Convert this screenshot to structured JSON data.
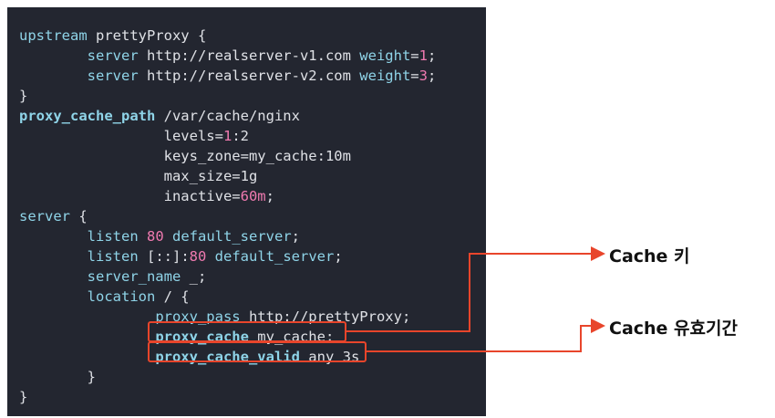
{
  "code_lines": [
    [
      {
        "t": "upstream",
        "c": "kw"
      },
      {
        "t": " prettyProxy {"
      }
    ],
    [
      {
        "t": "        "
      },
      {
        "t": "server",
        "c": "kw"
      },
      {
        "t": " http://realserver-v1.com "
      },
      {
        "t": "weight",
        "c": "kw"
      },
      {
        "t": "="
      },
      {
        "t": "1",
        "c": "num"
      },
      {
        "t": ";"
      }
    ],
    [
      {
        "t": "        "
      },
      {
        "t": "server",
        "c": "kw"
      },
      {
        "t": " http://realserver-v2.com "
      },
      {
        "t": "weight",
        "c": "kw"
      },
      {
        "t": "="
      },
      {
        "t": "3",
        "c": "num"
      },
      {
        "t": ";"
      }
    ],
    [
      {
        "t": "}"
      }
    ],
    [
      {
        "t": "proxy_cache_path",
        "c": "kwb"
      },
      {
        "t": " /var/cache/nginx"
      }
    ],
    [
      {
        "t": "                 levels="
      },
      {
        "t": "1",
        "c": "num"
      },
      {
        "t": ":2"
      }
    ],
    [
      {
        "t": "                 keys_zone=my_cache:10m"
      }
    ],
    [
      {
        "t": "                 max_size=1g"
      }
    ],
    [
      {
        "t": "                 inactive="
      },
      {
        "t": "60m",
        "c": "num"
      },
      {
        "t": ";"
      }
    ],
    [
      {
        "t": "server",
        "c": "kw"
      },
      {
        "t": " {"
      }
    ],
    [
      {
        "t": "        "
      },
      {
        "t": "listen",
        "c": "kw"
      },
      {
        "t": " "
      },
      {
        "t": "80",
        "c": "num"
      },
      {
        "t": " "
      },
      {
        "t": "default_server",
        "c": "kw"
      },
      {
        "t": ";"
      }
    ],
    [
      {
        "t": "        "
      },
      {
        "t": "listen",
        "c": "kw"
      },
      {
        "t": " [::]:"
      },
      {
        "t": "80",
        "c": "num"
      },
      {
        "t": " "
      },
      {
        "t": "default_server",
        "c": "kw"
      },
      {
        "t": ";"
      }
    ],
    [
      {
        "t": "        "
      },
      {
        "t": "server_name",
        "c": "kw"
      },
      {
        "t": " _;"
      }
    ],
    [
      {
        "t": "        "
      },
      {
        "t": "location",
        "c": "kw"
      },
      {
        "t": " / {"
      }
    ],
    [
      {
        "t": "                "
      },
      {
        "t": "proxy_pass",
        "c": "kw"
      },
      {
        "t": " http://prettyProxy;"
      }
    ],
    [
      {
        "t": "                "
      },
      {
        "t": "proxy_cache",
        "c": "kwb"
      },
      {
        "t": " my_cache;"
      }
    ],
    [
      {
        "t": "                "
      },
      {
        "t": "proxy_cache_valid",
        "c": "kwb"
      },
      {
        "t": " any 3s"
      }
    ],
    [
      {
        "t": "        }"
      }
    ],
    [
      {
        "t": "}"
      }
    ]
  ],
  "annotations": {
    "cache_key_label": "Cache 키",
    "cache_valid_label": "Cache 유효기간"
  },
  "colors": {
    "background": "#232630",
    "highlight": "#e8452b",
    "keyword": "#8fd4e8",
    "number": "#f07ab0"
  }
}
